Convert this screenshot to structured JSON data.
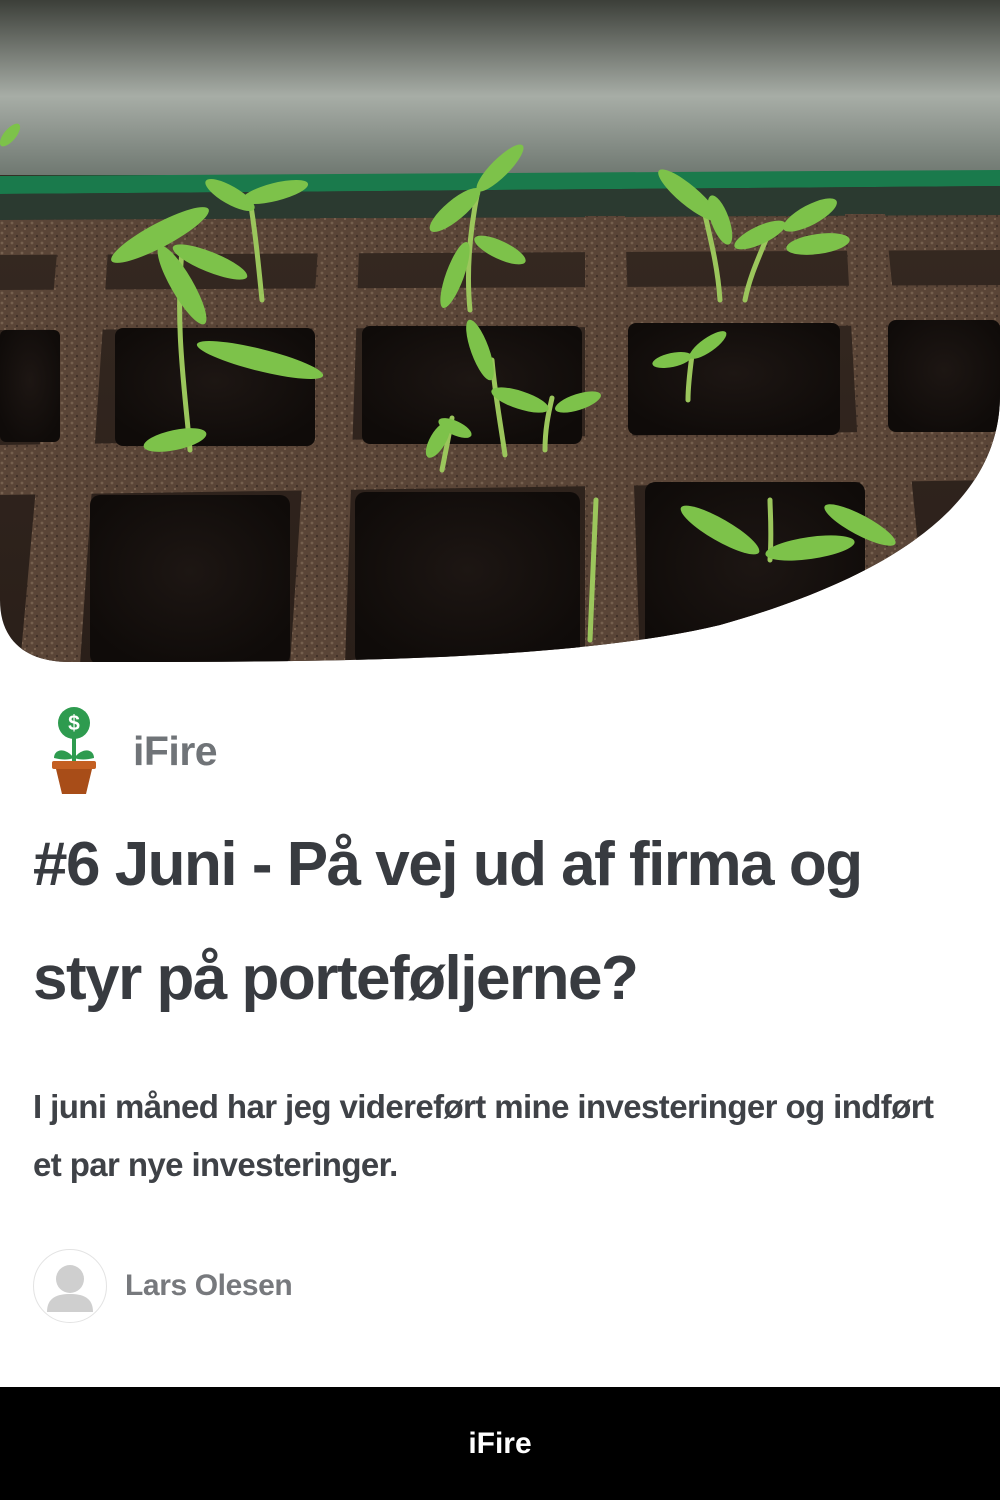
{
  "hero": {
    "image_icon": "seedlings-in-soil-tray-photo"
  },
  "brand": {
    "logo_icon": "money-plant-pot-icon",
    "logo_symbol": "$",
    "name": "iFire"
  },
  "article": {
    "title": "#6 Juni - På vej ud af firma og styr på porteføljerne?",
    "subtitle": "I juni måned har jeg videreført mine investeringer og indført et par nye investeringer."
  },
  "author": {
    "avatar_icon": "default-user-avatar-icon",
    "name": "Lars Olesen"
  },
  "footer": {
    "label": "iFire"
  },
  "colors": {
    "title": "#383b40",
    "muted": "#707478",
    "footer_bg": "#000000",
    "footer_text": "#ffffff",
    "logo_green": "#2e9b4f",
    "logo_pot": "#b8561c"
  }
}
